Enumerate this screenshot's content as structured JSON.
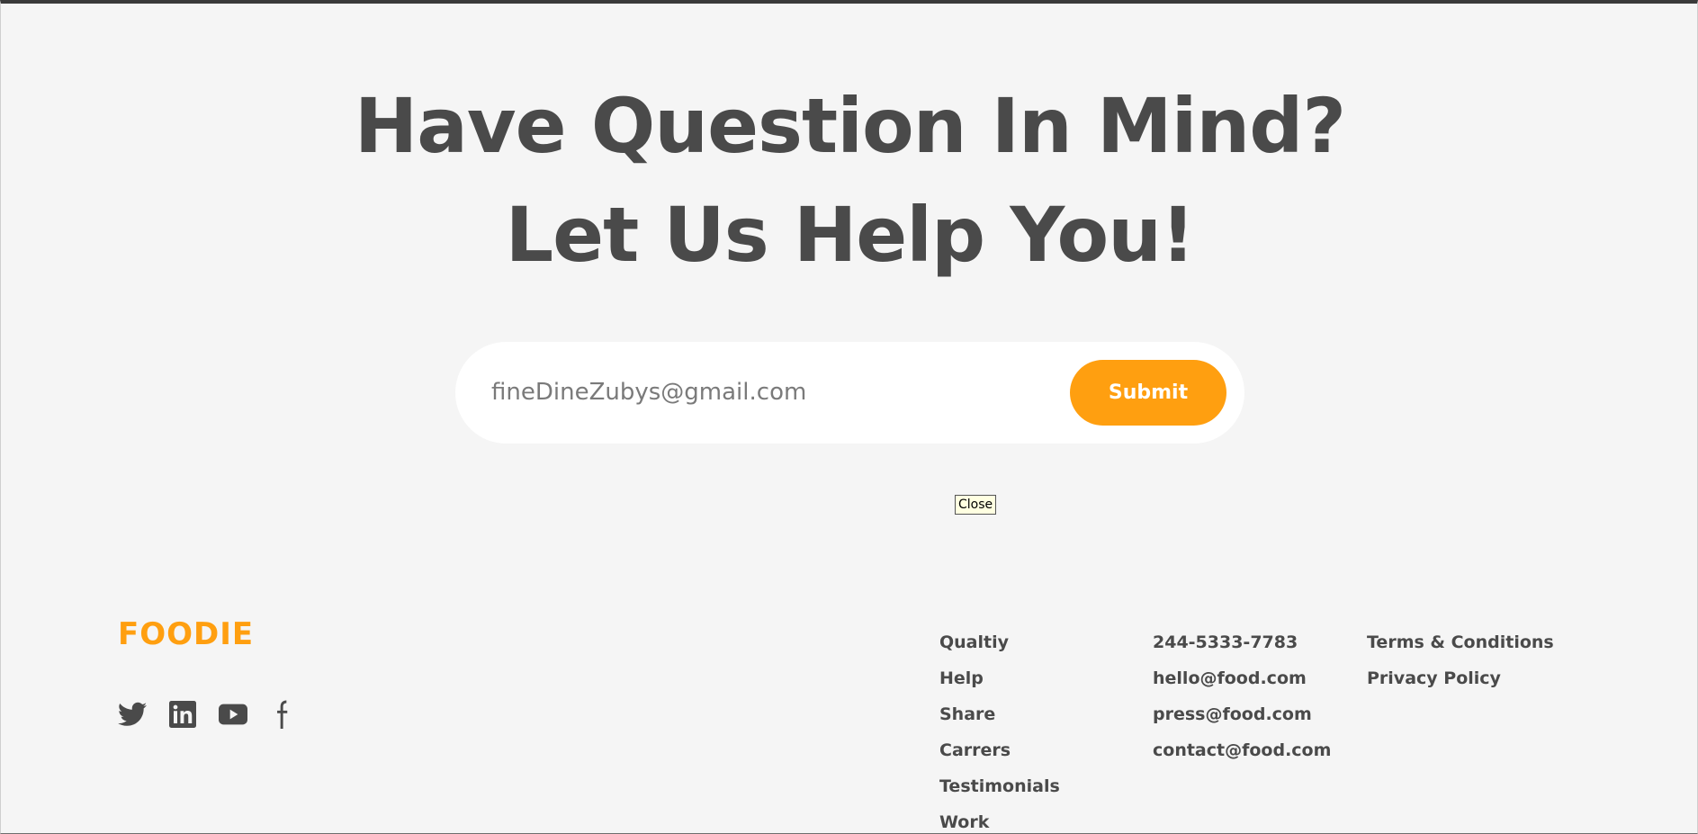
{
  "hero": {
    "line1": "Have Question In Mind?",
    "line2": "Let Us Help You!"
  },
  "subscribe": {
    "email_value": "fineDineZubys@gmail.com",
    "submit_label": "Submit"
  },
  "tooltip": {
    "close_label": "Close"
  },
  "footer": {
    "brand": "FOODIE",
    "socials": [
      "twitter-icon",
      "linkedin-icon",
      "youtube-icon",
      "facebook-icon"
    ],
    "links_col1": [
      "Qualtiy",
      "Help",
      "Share",
      "Carrers",
      "Testimonials",
      "Work"
    ],
    "links_col2": [
      "244-5333-7783",
      "hello@food.com",
      "press@food.com",
      "contact@food.com"
    ],
    "links_col3": [
      "Terms & Conditions",
      "Privacy Policy"
    ]
  },
  "colors": {
    "accent": "#ff9f10",
    "text": "#4a4a4a",
    "background": "#f5f5f5"
  }
}
